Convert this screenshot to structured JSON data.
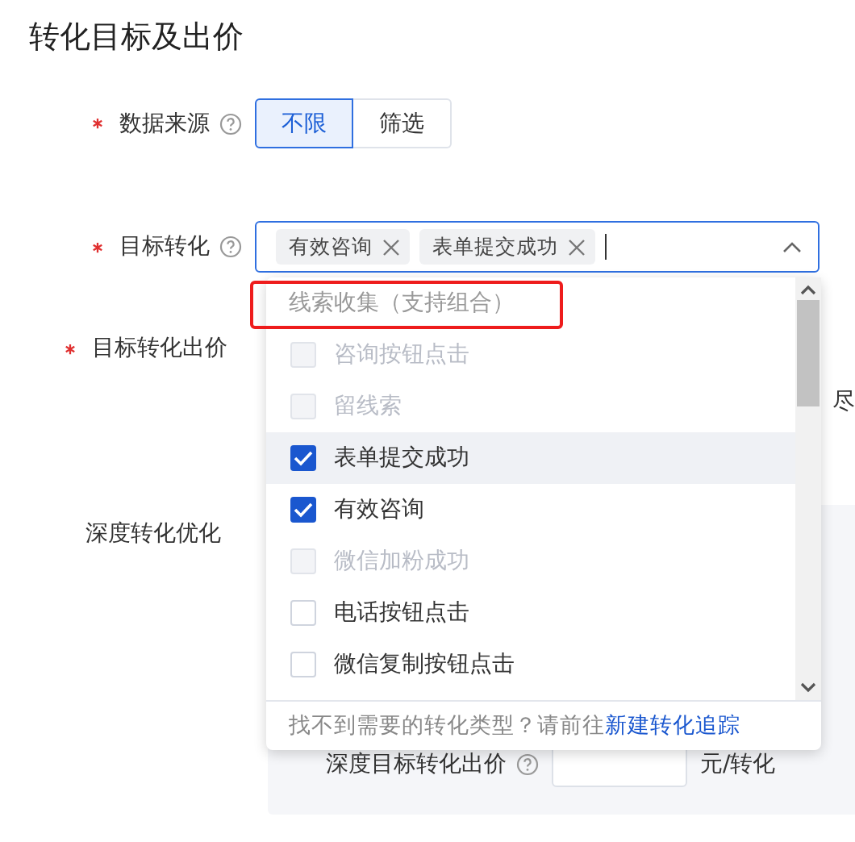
{
  "title": "转化目标及出价",
  "data_source": {
    "label": "数据来源",
    "required": true,
    "options": [
      {
        "label": "不限",
        "selected": true
      },
      {
        "label": "筛选",
        "selected": false
      }
    ]
  },
  "target_conversion": {
    "label": "目标转化",
    "required": true,
    "tags": [
      "有效咨询",
      "表单提交成功"
    ],
    "expanded": true
  },
  "bid": {
    "label": "目标转化出价",
    "required": true,
    "trailing_text": "尽"
  },
  "deep": {
    "label": "深度转化优化",
    "bid_label": "深度目标转化出价",
    "unit": "元/转化"
  },
  "dropdown": {
    "group": "线索收集（支持组合）",
    "group_highlighted": true,
    "items": [
      {
        "label": "咨询按钮点击",
        "checked": false,
        "disabled": true,
        "hovered": false
      },
      {
        "label": "留线索",
        "checked": false,
        "disabled": true,
        "hovered": false
      },
      {
        "label": "表单提交成功",
        "checked": true,
        "disabled": false,
        "hovered": true
      },
      {
        "label": "有效咨询",
        "checked": true,
        "disabled": false,
        "hovered": false
      },
      {
        "label": "微信加粉成功",
        "checked": false,
        "disabled": true,
        "hovered": false
      },
      {
        "label": "电话按钮点击",
        "checked": false,
        "disabled": false,
        "hovered": false
      },
      {
        "label": "微信复制按钮点击",
        "checked": false,
        "disabled": false,
        "hovered": false
      }
    ],
    "footer_text": "找不到需要的转化类型？请前往",
    "footer_link": "新建转化追踪"
  }
}
